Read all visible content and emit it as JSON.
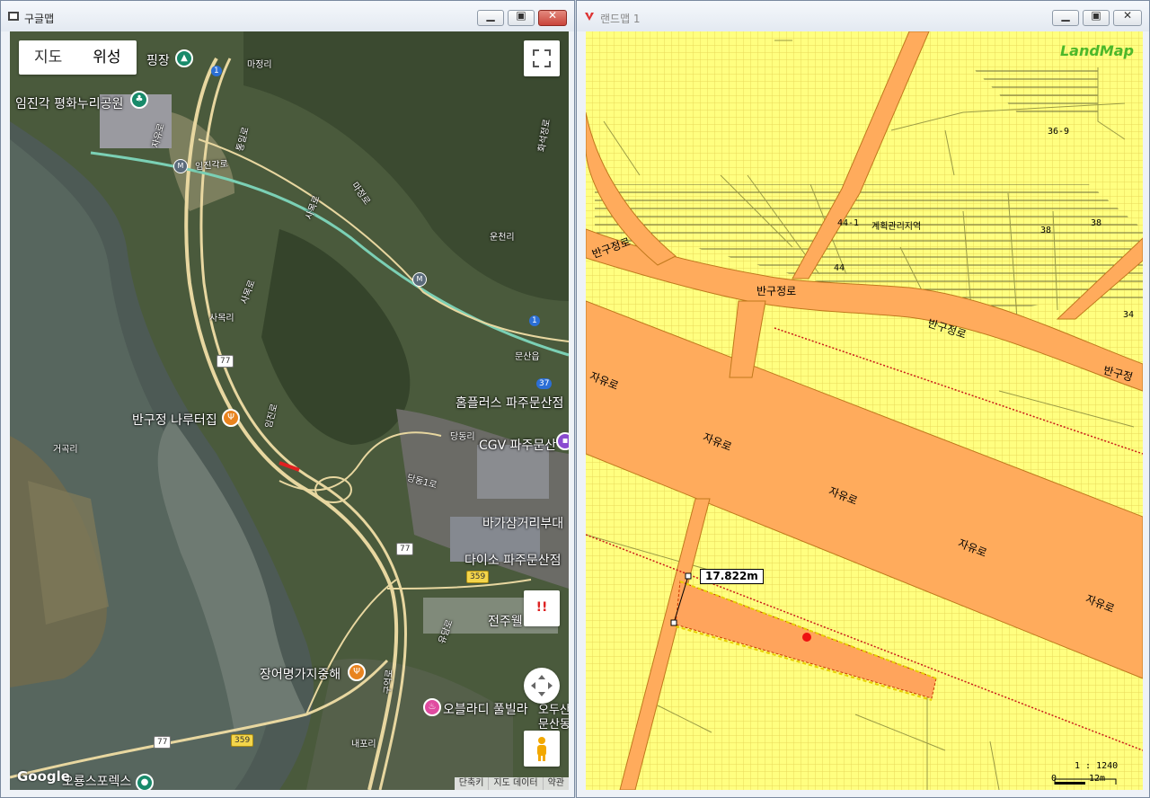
{
  "left_window": {
    "title": "구글맵",
    "map_type_buttons": [
      "지도",
      "위성"
    ],
    "labels": {
      "campground": "핑장",
      "park": "임진각 평화누리공원",
      "majeongri": "마정리",
      "jayuro1": "자유로",
      "imjingakro": "임진각로",
      "tongilro": "통일로",
      "majeongro": "마정로",
      "sangmunro": "사목로",
      "hwaseokro": "화석정로",
      "sagmokro": "사목로",
      "samokri": "사목리",
      "unjeonri": "운천리",
      "munsaneup": "문산읍",
      "homeplus": "홈플러스 파주문산점",
      "bangujeong": "반구정 나루터집",
      "geogokri": "거곡리",
      "dangdongri": "당동리",
      "cgv": "CGV 파주문산",
      "dangdong1ro": "당동1로",
      "bagasam": "바가삼거리부대",
      "daiso": "다이소 파주문산점",
      "jeonjuwel": "전주웰",
      "jangeo": "장어명가지중해",
      "orlando": "오블라디 풀빌라",
      "odu": "오두산",
      "munsandong": "문산동",
      "naepori": "내포리",
      "sports": "오룡스포렉스",
      "imjinro": "임진로",
      "yudapro": "유담로",
      "gueomro": "구억로",
      "jayuro2": "자유로"
    },
    "shields": {
      "r1a": "1",
      "r1b": "1",
      "r37": "37",
      "r77a": "77",
      "r77b": "77",
      "r77c": "77",
      "r359a": "359",
      "r359b": "359",
      "m1": "M",
      "m2": "M"
    },
    "warning_glyph": "!!",
    "google_logo": "Google",
    "footer": [
      "단축키",
      "지도 데이터",
      "약관"
    ]
  },
  "right_window": {
    "title": "랜드맵 1",
    "logo": "LandMap",
    "road_labels": {
      "bangujeongro_left": "반구정로",
      "bangujeongro_mid": "반구정로",
      "bangujeongro_right": "반구정로",
      "bangujeongro_far": "반구정",
      "jayuro_a": "자유로",
      "jayuro_b": "자유로",
      "jayuro_c": "자유로",
      "jayuro_d": "자유로",
      "jayuro_e": "자유로"
    },
    "parcel_labels": {
      "p36_9": "36-9",
      "p44_1": "44-1",
      "zone": "계획관리지역",
      "p38a": "38",
      "p38b": "38",
      "p44": "44",
      "p34": "34"
    },
    "measurement": "17.822m",
    "scale": {
      "ratio": "1 : 1240",
      "zero": "0",
      "length": "12m"
    },
    "colors": {
      "base": "#ffff80",
      "road": "#ffab5c",
      "grid": "#e8d95a",
      "parcel_line": "#9a9a45"
    }
  }
}
